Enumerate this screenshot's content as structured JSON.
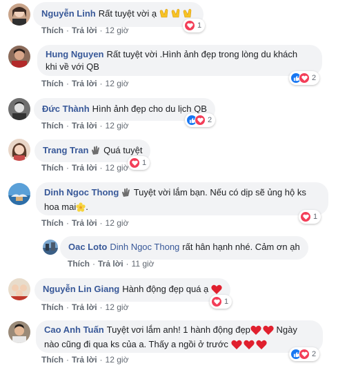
{
  "actions": {
    "like": "Thích",
    "reply": "Trả lời",
    "sep": "·"
  },
  "comments": [
    {
      "author": "Nguyễn Linh",
      "text": "Rất tuyệt vời ạ",
      "text2": "",
      "time": "12 giờ",
      "reaction_count": "1"
    },
    {
      "author": "Hung Nguyen",
      "text": "Rất tuyệt vời .Hình ảnh đẹp trong lòng du khách",
      "text2": "khi về với QB",
      "time": "12 giờ",
      "reaction_count": "2"
    },
    {
      "author": "Đức Thành",
      "text": "Hình ảnh đẹp cho du lịch QB",
      "text2": "",
      "time": "12 giờ",
      "reaction_count": "2"
    },
    {
      "author": "Trang Tran",
      "text": "Quá tuyệt",
      "text2": "",
      "time": "12 giờ",
      "reaction_count": "1"
    },
    {
      "author": "Dinh Ngoc Thong",
      "text": "Tuyệt vời lắm bạn. Nếu có dịp sẽ ủng hộ ks",
      "text2": "hoa mai",
      "time": "12 giờ",
      "reaction_count": "1"
    },
    {
      "author": "Oac Loto",
      "mention": "Dinh Ngoc Thong",
      "text": "rất hân hạnh nhé. Cảm ơn ạh",
      "text2": "",
      "time": "11 giờ",
      "reaction_count": ""
    },
    {
      "author": "Nguyễn Lin Giang",
      "text": "Hành động đẹp quá ạ",
      "text2": "",
      "time": "12 giờ",
      "reaction_count": "1"
    },
    {
      "author": "Cao Anh Tuấn",
      "text": "Tuyệt vơi lắm anh! 1 hành động đẹp",
      "text2": "Ngày",
      "text3": "nào cũng đi qua ks của a. Thấy a ngồi ở trước",
      "time": "12 giờ",
      "reaction_count": "2"
    }
  ],
  "colors": {
    "author": "#385898",
    "bubble": "#f2f3f5",
    "meta": "#606770",
    "heart": "#f33e58",
    "like": "#1877f2"
  },
  "icons": {
    "reaction_heart": "heart-icon",
    "reaction_like": "like-icon",
    "emoji_clap": "clapping-hands-icon",
    "emoji_wave": "waving-hand-icon",
    "emoji_flower": "blossom-icon",
    "emoji_heart": "red-heart-icon"
  }
}
